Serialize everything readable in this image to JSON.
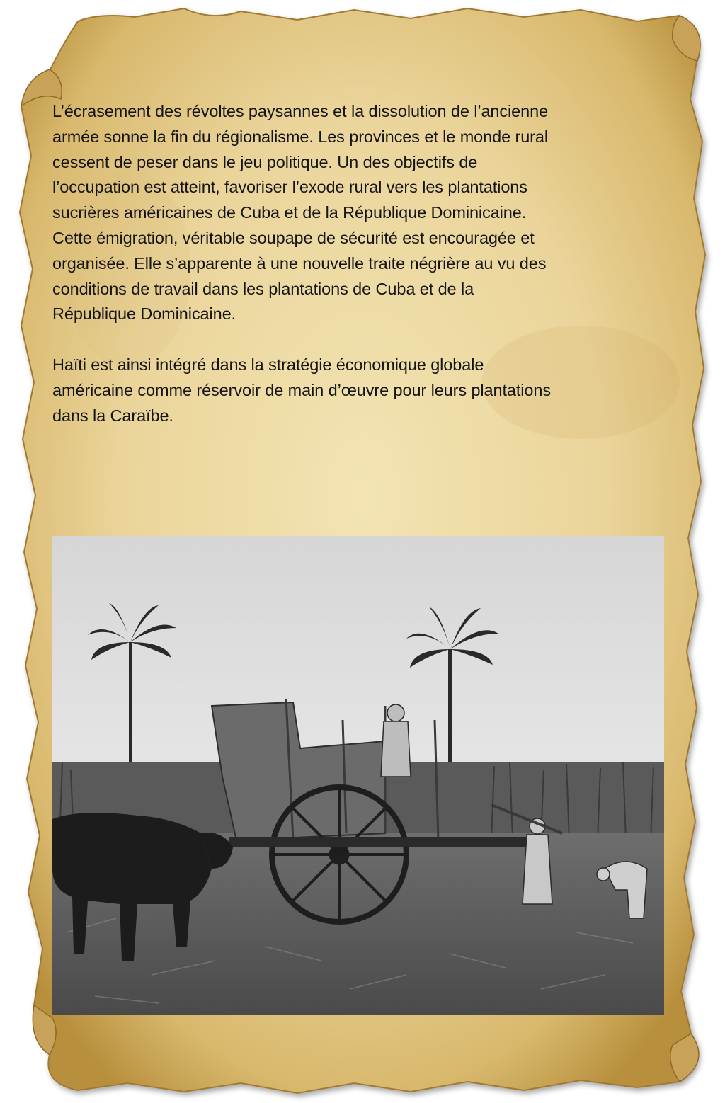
{
  "page": {
    "paragraphs": [
      "L’écrasement des révoltes paysannes et la dissolution de l’ancienne\narmée sonne la fin du régionalisme. Les provinces et le monde rural\ncessent de peser dans le jeu politique. Un des objectifs de\nl’occupation est atteint, favoriser l’exode rural vers les plantations\nsucrières américaines de Cuba et de la République Dominicaine.\nCette émigration, véritable soupape de sécurité est encouragée et\norganisée. Elle s’apparente à une nouvelle traite négrière au vu des\nconditions de travail dans les plantations de Cuba et de la\nRépublique Dominicaine.",
      "Haïti est ainsi intégré dans la stratégie économique globale\naméricaine comme réservoir de main d’œuvre pour leurs plantations\ndans la Caraïbe."
    ]
  },
  "colors": {
    "parchment": "#e8d49a",
    "parchment_edge": "#b8903e",
    "text": "#151515"
  }
}
